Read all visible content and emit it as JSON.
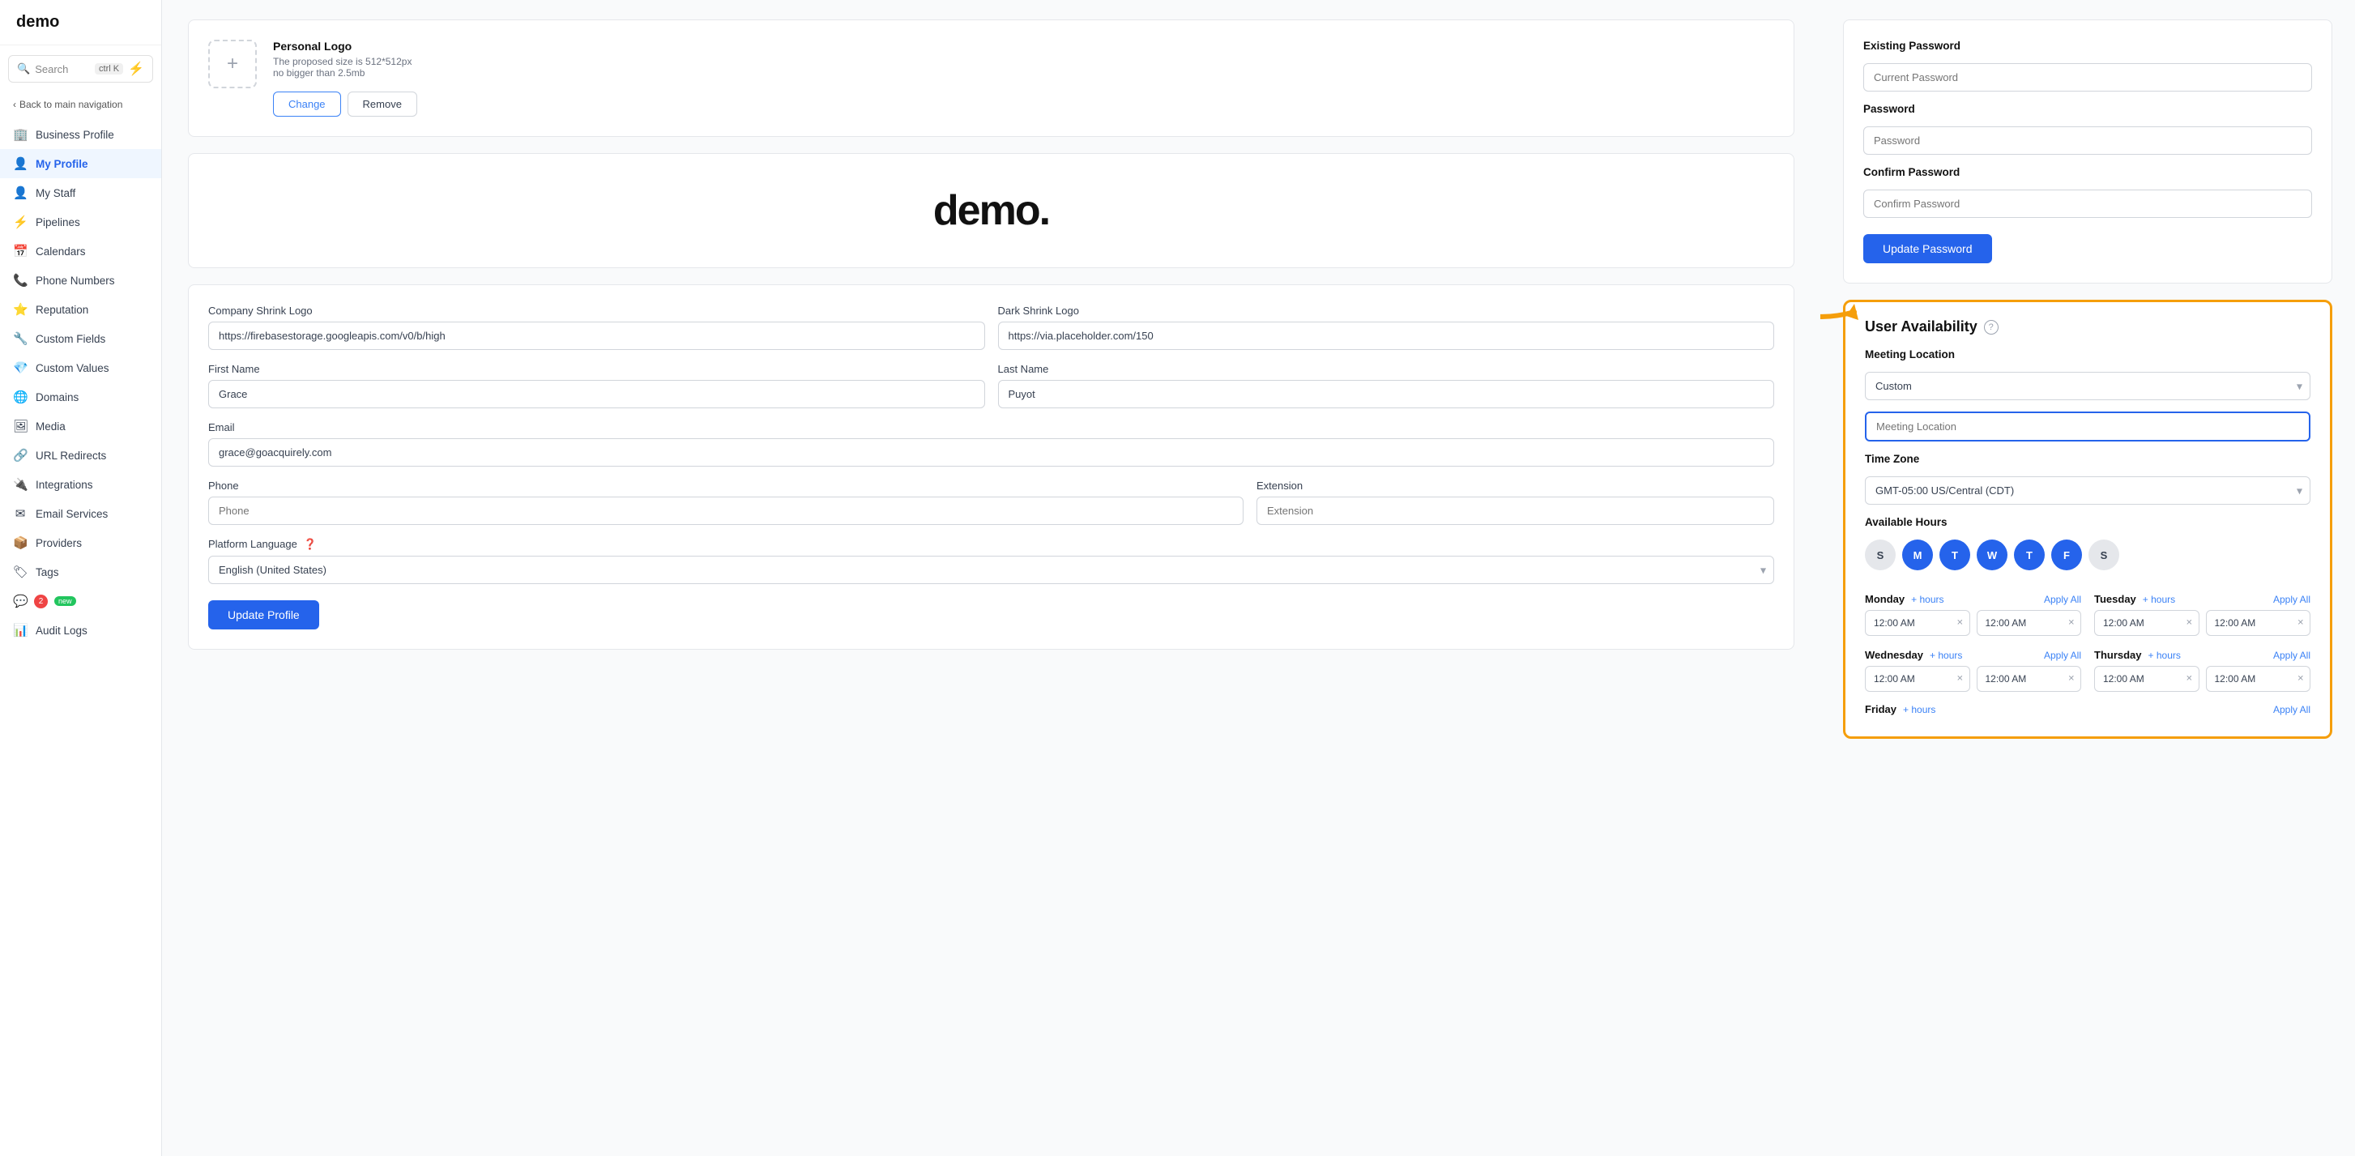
{
  "app": {
    "name": "demo"
  },
  "sidebar": {
    "search_label": "Search",
    "search_kbd": "ctrl K",
    "back_label": "Back to main navigation",
    "items": [
      {
        "id": "business-profile",
        "label": "Business Profile",
        "icon": "🏢",
        "active": false
      },
      {
        "id": "my-profile",
        "label": "My Profile",
        "icon": "👤",
        "active": true
      },
      {
        "id": "my-staff",
        "label": "My Staff",
        "icon": "👤",
        "active": false
      },
      {
        "id": "pipelines",
        "label": "Pipelines",
        "icon": "⚡",
        "active": false
      },
      {
        "id": "calendars",
        "label": "Calendars",
        "icon": "📅",
        "active": false
      },
      {
        "id": "phone-numbers",
        "label": "Phone Numbers",
        "icon": "📞",
        "active": false
      },
      {
        "id": "reputation",
        "label": "Reputation",
        "icon": "⭐",
        "active": false
      },
      {
        "id": "custom-fields",
        "label": "Custom Fields",
        "icon": "🔧",
        "active": false
      },
      {
        "id": "custom-values",
        "label": "Custom Values",
        "icon": "💎",
        "active": false
      },
      {
        "id": "domains",
        "label": "Domains",
        "icon": "🌐",
        "active": false
      },
      {
        "id": "media",
        "label": "Media",
        "icon": "🖼",
        "active": false
      },
      {
        "id": "url-redirects",
        "label": "URL Redirects",
        "icon": "🔗",
        "active": false
      },
      {
        "id": "integrations",
        "label": "Integrations",
        "icon": "🔌",
        "active": false
      },
      {
        "id": "email-services",
        "label": "Email Services",
        "icon": "✉",
        "active": false
      },
      {
        "id": "providers",
        "label": "Providers",
        "icon": "📦",
        "active": false
      },
      {
        "id": "tags",
        "label": "Tags",
        "icon": "🏷",
        "active": false
      },
      {
        "id": "chat",
        "label": "💬",
        "badge": "2",
        "new_badge": "new",
        "active": false
      },
      {
        "id": "audit-logs",
        "label": "Audit Logs",
        "icon": "📊",
        "active": false
      }
    ]
  },
  "left_panel": {
    "personal_logo": {
      "title": "Personal Logo",
      "subtitle_line1": "The proposed size is 512*512px",
      "subtitle_line2": "no bigger than 2.5mb",
      "change_btn": "Change",
      "remove_btn": "Remove"
    },
    "demo_logo": "demo.",
    "company_shrink_logo_label": "Company Shrink Logo",
    "company_shrink_logo_value": "https://firebasestorage.googleapis.com/v0/b/high",
    "dark_shrink_logo_label": "Dark Shrink Logo",
    "dark_shrink_logo_value": "https://via.placeholder.com/150",
    "first_name_label": "First Name",
    "first_name_value": "Grace",
    "last_name_label": "Last Name",
    "last_name_value": "Puyot",
    "email_label": "Email",
    "email_value": "grace@goacquirely.com",
    "phone_label": "Phone",
    "phone_placeholder": "Phone",
    "extension_label": "Extension",
    "extension_placeholder": "Extension",
    "platform_language_label": "Platform Language",
    "platform_language_value": "English (United States)",
    "update_profile_btn": "Update Profile"
  },
  "right_panel": {
    "existing_password_label": "Existing Password",
    "current_password_placeholder": "Current Password",
    "password_label": "Password",
    "password_placeholder": "Password",
    "confirm_password_label": "Confirm Password",
    "confirm_password_placeholder": "Confirm Password",
    "update_password_btn": "Update Password",
    "user_availability_title": "User Availability",
    "meeting_location_label": "Meeting Location",
    "meeting_location_select": "Custom",
    "meeting_location_placeholder": "Meeting Location",
    "time_zone_label": "Time Zone",
    "time_zone_value": "GMT-05:00 US/Central (CDT)",
    "available_hours_label": "Available Hours",
    "days": [
      {
        "label": "S",
        "active": false
      },
      {
        "label": "M",
        "active": true
      },
      {
        "label": "T",
        "active": true
      },
      {
        "label": "W",
        "active": true
      },
      {
        "label": "T",
        "active": true
      },
      {
        "label": "F",
        "active": true
      },
      {
        "label": "S",
        "active": false
      }
    ],
    "hours": [
      {
        "day": "Monday",
        "add_hours": "+ hours",
        "apply_all": "Apply All",
        "start": "12:00 AM",
        "end": "12:00 AM"
      },
      {
        "day": "Tuesday",
        "add_hours": "+ hours",
        "apply_all": "Apply All",
        "start": "12:00 AM",
        "end": "12:00 AM"
      },
      {
        "day": "Wednesday",
        "add_hours": "+ hours",
        "apply_all": "Apply All",
        "start": "12:00 AM",
        "end": "12:00 AM"
      },
      {
        "day": "Thursday",
        "add_hours": "+ hours",
        "apply_all": "Apply All",
        "start": "12:00 AM",
        "end": "12:00 AM"
      }
    ]
  }
}
